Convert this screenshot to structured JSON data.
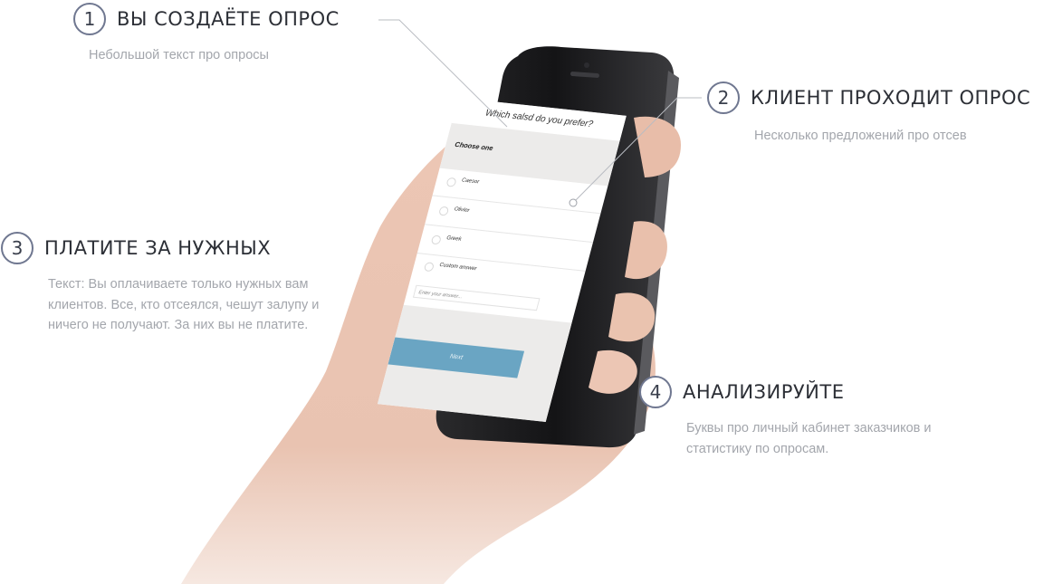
{
  "steps": [
    {
      "number": "1",
      "title": "ВЫ СОЗДАЁТЕ ОПРОС",
      "text": "Небольшой текст про опросы"
    },
    {
      "number": "2",
      "title": "КЛИЕНТ ПРОХОДИТ ОПРОС",
      "text": "Несколько предложений про отсев"
    },
    {
      "number": "3",
      "title": "ПЛАТИТЕ ЗА НУЖНЫХ",
      "text": "Текст: Вы оплачиваете только нужных вам клиентов. Все, кто отсеялся, чешут залупу и ничего не получают. За них вы не платите."
    },
    {
      "number": "4",
      "title": "АНАЛИЗИРУЙТЕ",
      "text": "Буквы про личный кабинет заказчиков и статистику по опросам."
    }
  ],
  "phone_screen": {
    "question": "Which salsd do you prefer?",
    "choose_label": "Choose one",
    "options": [
      "Caesor",
      "Olivier",
      "Greek",
      "Custom answer"
    ],
    "answer_placeholder": "Enter your answer...",
    "next_label": "Next"
  },
  "colors": {
    "accent_button": "#6aa5c3",
    "circle_border": "#6f7790",
    "title_text": "#2c2f36",
    "desc_text": "#a3a6ac"
  }
}
